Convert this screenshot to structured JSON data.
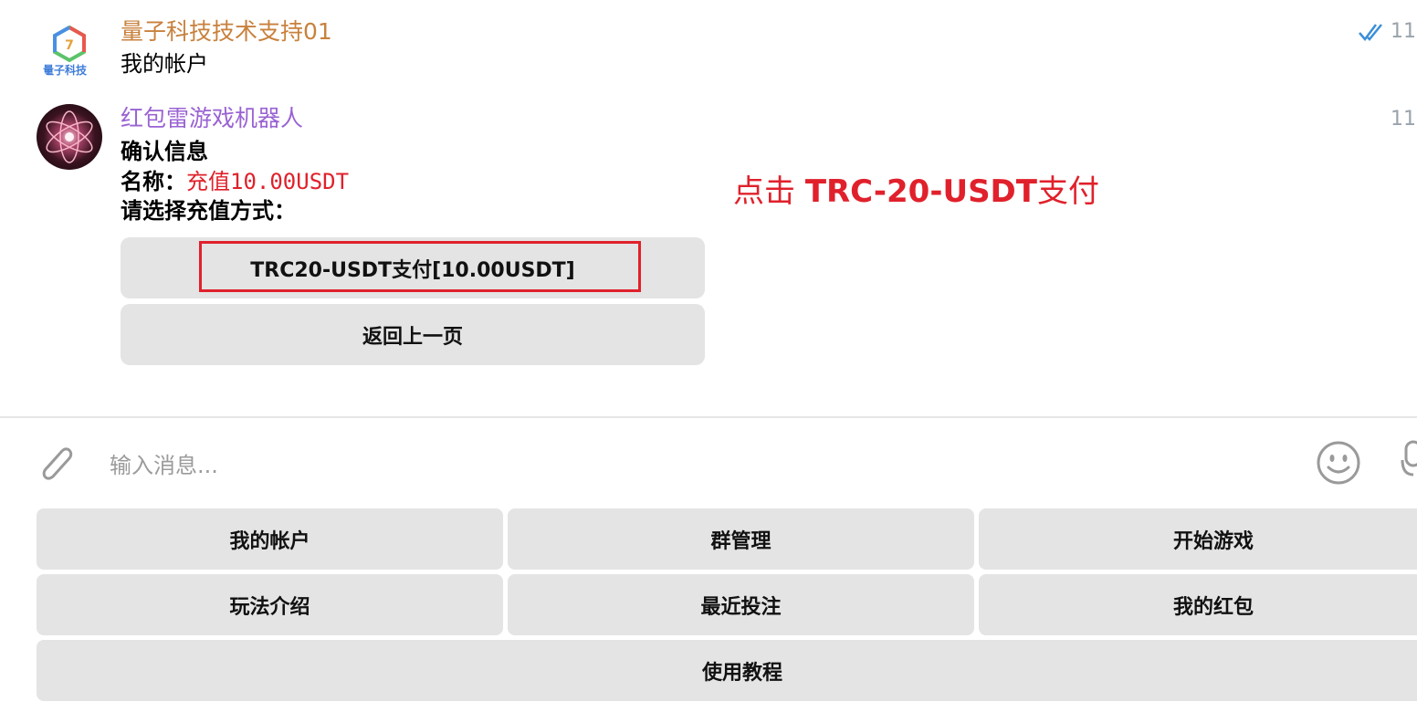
{
  "messages": [
    {
      "sender": "量子科技技术支持01",
      "sender_color": "#c8813d",
      "text": "我的帐户",
      "time": "11:",
      "avatar_label": "量子科技"
    },
    {
      "sender": "红包雷游戏机器人",
      "sender_color": "#9a63d3",
      "title": "确认信息",
      "name_label": "名称：",
      "name_value": "充值10.00USDT",
      "prompt": "请选择充值方式：",
      "time": "11:",
      "buttons": [
        "TRC20-USDT支付[10.00USDT]",
        "返回上一页"
      ]
    }
  ],
  "annotation": {
    "prefix": "点击 ",
    "bold": "TRC-20-USDT",
    "suffix": "支付"
  },
  "input": {
    "placeholder": "输入消息..."
  },
  "keyboard": {
    "rows": [
      [
        "我的帐户",
        "群管理",
        "开始游戏"
      ],
      [
        "玩法介绍",
        "最近投注",
        "我的红包"
      ],
      [
        "使用教程"
      ]
    ]
  },
  "colors": {
    "accent_red": "#e0212b",
    "check_blue": "#3d8fd8",
    "button_bg": "#e4e4e4"
  },
  "icons": [
    "attach-icon",
    "emoji-icon",
    "mic-icon",
    "double-check-icon"
  ]
}
